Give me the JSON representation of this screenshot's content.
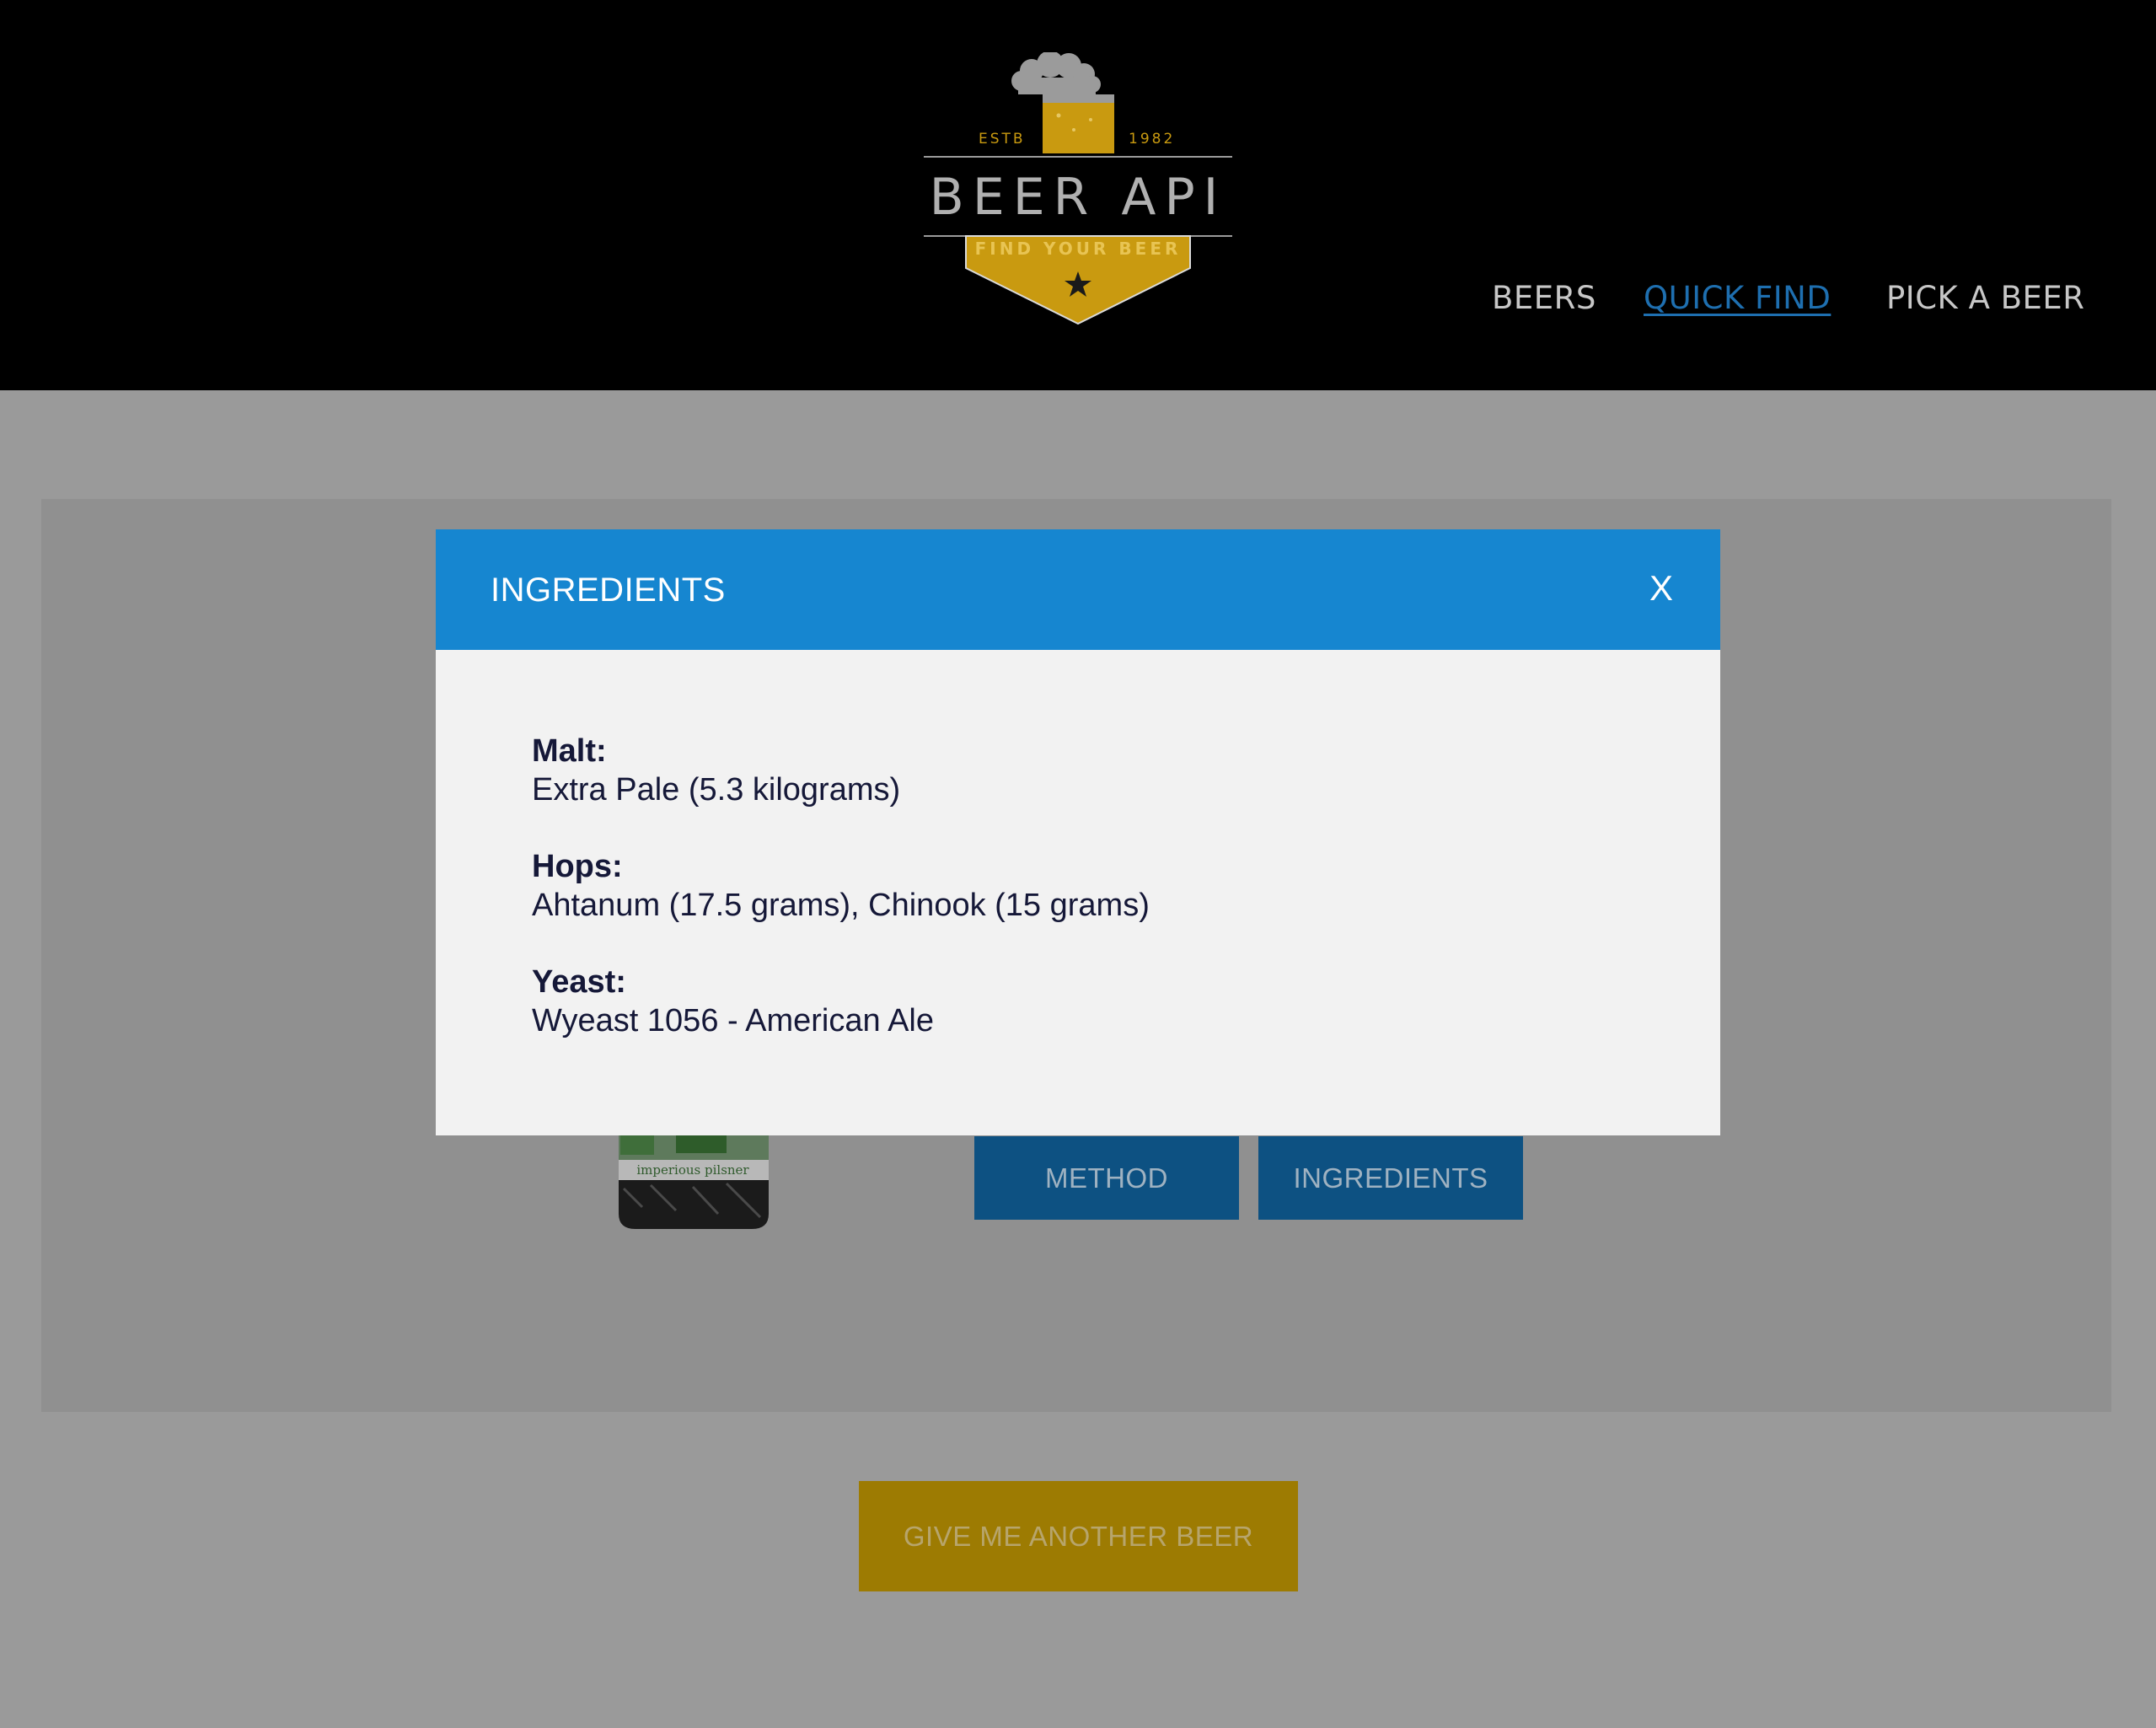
{
  "logo": {
    "estb": "ESTB",
    "year": "1982",
    "name": "BEER API",
    "tagline": "FIND YOUR BEER"
  },
  "nav": {
    "items": [
      {
        "label": "BEERS",
        "active": false
      },
      {
        "label": "QUICK  FIND",
        "active": true
      },
      {
        "label": "PICK A BEER",
        "active": false
      }
    ]
  },
  "beer": {
    "bottle_label_text": "imperious pilsner"
  },
  "actions": {
    "method_label": "METHOD",
    "ingredients_label": "INGREDIENTS",
    "another_label": "GIVE ME ANOTHER BEER"
  },
  "modal": {
    "title": "INGREDIENTS",
    "close_label": "X",
    "sections": [
      {
        "label": "Malt:",
        "value": "Extra Pale (5.3 kilograms)"
      },
      {
        "label": "Hops:",
        "value": "Ahtanum (17.5 grams), Chinook (15 grams)"
      },
      {
        "label": "Yeast:",
        "value": "Wyeast 1056 - American Ale"
      }
    ]
  },
  "colors": {
    "header_bg": "#000000",
    "modal_header": "#1686d0",
    "button_blue": "#0d5182",
    "button_gold": "#9d7b02",
    "logo_gold": "#c99a10",
    "overlay": "#9a9a9a"
  }
}
